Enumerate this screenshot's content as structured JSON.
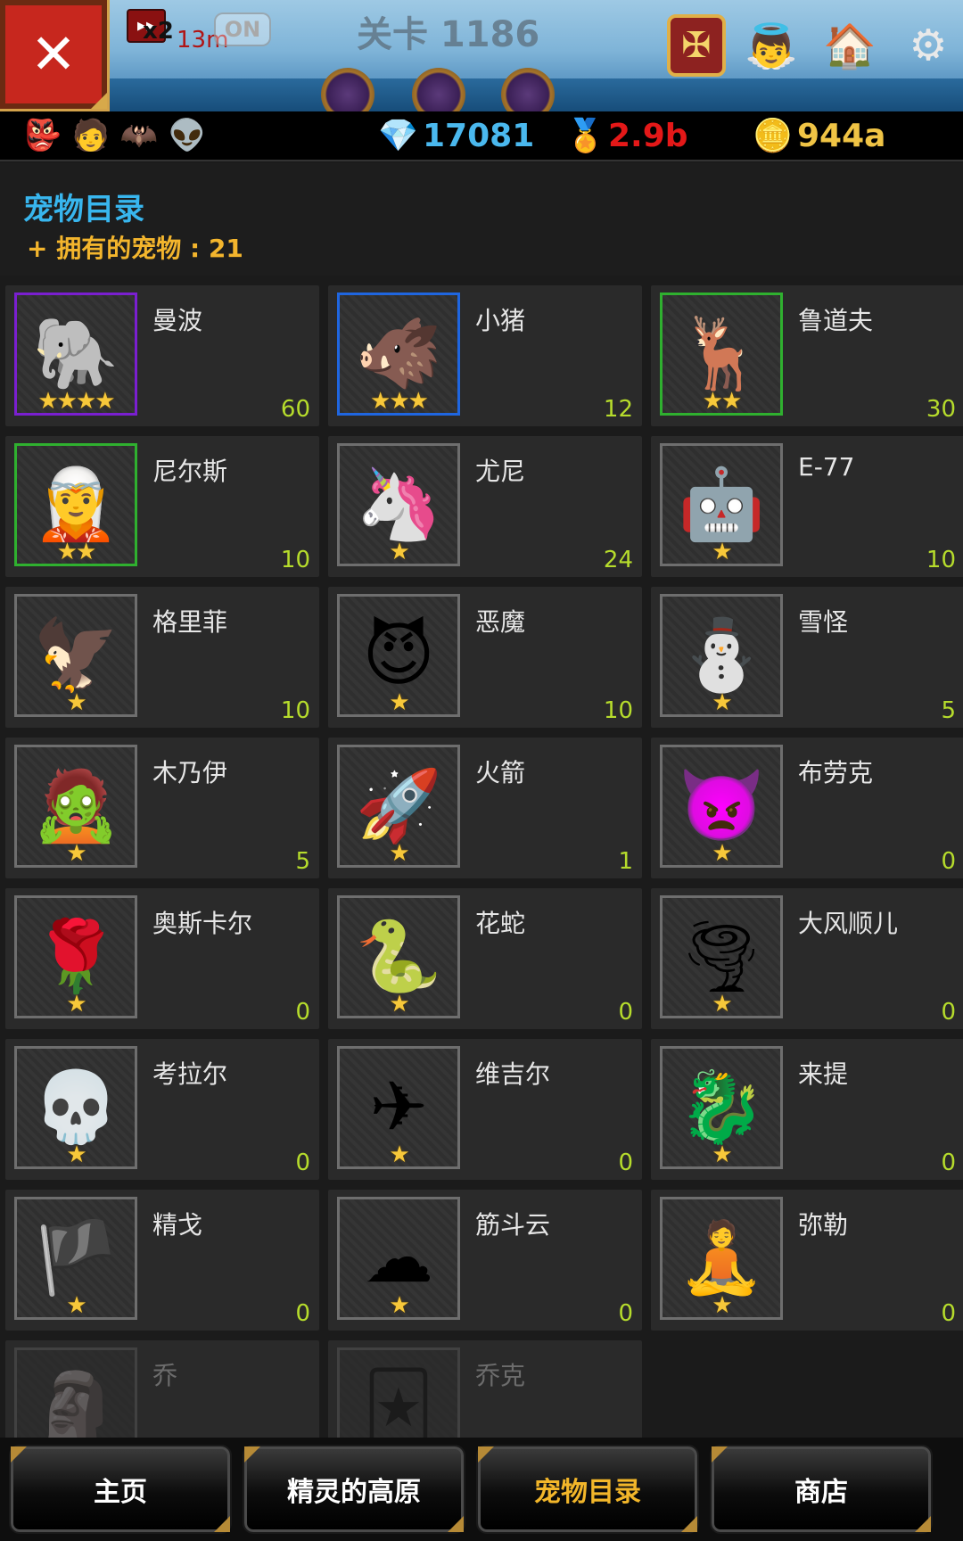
{
  "topbar": {
    "close_label": "✕",
    "speed_multiplier": "x2",
    "speed_timer": "13m",
    "auto_toggle": "ON",
    "stage_title": "关卡 1186"
  },
  "resources": {
    "gems": "17081",
    "medals": "2.9b",
    "gold": "944a"
  },
  "catalog": {
    "title": "宠物目录",
    "owned_label": "+ 拥有的宠物 : 21"
  },
  "pets": [
    {
      "name": "曼波",
      "count": "60",
      "stars": "★★★★",
      "border": "purple",
      "icon": "elephant-pet-icon",
      "glyph": "🐘",
      "locked": false
    },
    {
      "name": "小猪",
      "count": "12",
      "stars": "★★★",
      "border": "blue",
      "icon": "boar-pet-icon",
      "glyph": "🐗",
      "locked": false
    },
    {
      "name": "鲁道夫",
      "count": "30",
      "stars": "★★",
      "border": "green",
      "icon": "reindeer-pet-icon",
      "glyph": "🦌",
      "locked": false
    },
    {
      "name": "尼尔斯",
      "count": "10",
      "stars": "★★",
      "border": "green",
      "icon": "elf-pet-icon",
      "glyph": "🧝",
      "locked": false
    },
    {
      "name": "尤尼",
      "count": "24",
      "stars": "★",
      "border": "gray",
      "icon": "pegasus-pet-icon",
      "glyph": "🦄",
      "locked": false
    },
    {
      "name": "E-77",
      "count": "10",
      "stars": "★",
      "border": "gray",
      "icon": "robot-pet-icon",
      "glyph": "🤖",
      "locked": false
    },
    {
      "name": "格里菲",
      "count": "10",
      "stars": "★",
      "border": "gray",
      "icon": "griffin-pet-icon",
      "glyph": "🦅",
      "locked": false
    },
    {
      "name": "恶魔",
      "count": "10",
      "stars": "★",
      "border": "gray",
      "icon": "devil-pet-icon",
      "glyph": "😈",
      "locked": false
    },
    {
      "name": "雪怪",
      "count": "5",
      "stars": "★",
      "border": "gray",
      "icon": "yeti-pet-icon",
      "glyph": "⛄",
      "locked": false
    },
    {
      "name": "木乃伊",
      "count": "5",
      "stars": "★",
      "border": "gray",
      "icon": "mummy-pet-icon",
      "glyph": "🧟",
      "locked": false
    },
    {
      "name": "火箭",
      "count": "1",
      "stars": "★",
      "border": "gray",
      "icon": "rocket-pet-icon",
      "glyph": "🚀",
      "locked": false
    },
    {
      "name": "布劳克",
      "count": "0",
      "stars": "★",
      "border": "gray",
      "icon": "imp-pet-icon",
      "glyph": "👿",
      "locked": false
    },
    {
      "name": "奥斯卡尔",
      "count": "0",
      "stars": "★",
      "border": "gray",
      "icon": "rose-pet-icon",
      "glyph": "🌹",
      "locked": false
    },
    {
      "name": "花蛇",
      "count": "0",
      "stars": "★",
      "border": "gray",
      "icon": "snake-pet-icon",
      "glyph": "🐍",
      "locked": false
    },
    {
      "name": "大风顺儿",
      "count": "0",
      "stars": "★",
      "border": "gray",
      "icon": "tornado-pet-icon",
      "glyph": "🌪",
      "locked": false
    },
    {
      "name": "考拉尔",
      "count": "0",
      "stars": "★",
      "border": "gray",
      "icon": "pharaoh-pet-icon",
      "glyph": "💀",
      "locked": false
    },
    {
      "name": "维吉尔",
      "count": "0",
      "stars": "★",
      "border": "gray",
      "icon": "plane-pet-icon",
      "glyph": "✈",
      "locked": false
    },
    {
      "name": "来提",
      "count": "0",
      "stars": "★",
      "border": "gray",
      "icon": "dragon-pet-icon",
      "glyph": "🐉",
      "locked": false
    },
    {
      "name": "精戈",
      "count": "0",
      "stars": "★",
      "border": "gray",
      "icon": "pirate-pet-icon",
      "glyph": "🏴",
      "locked": false
    },
    {
      "name": "筋斗云",
      "count": "0",
      "stars": "★",
      "border": "gray",
      "icon": "cloud-pet-icon",
      "glyph": "☁",
      "locked": false
    },
    {
      "name": "弥勒",
      "count": "0",
      "stars": "★",
      "border": "gray",
      "icon": "buddha-pet-icon",
      "glyph": "🧘",
      "locked": false
    },
    {
      "name": "乔",
      "count": "",
      "stars": "",
      "border": "gray",
      "icon": "totem-pet-icon",
      "glyph": "🗿",
      "locked": true
    },
    {
      "name": "乔克",
      "count": "",
      "stars": "",
      "border": "gray",
      "icon": "jester-pet-icon",
      "glyph": "🃏",
      "locked": true
    }
  ],
  "nav": {
    "home": "主页",
    "plateau": "精灵的高原",
    "catalog": "宠物目录",
    "shop": "商店"
  }
}
